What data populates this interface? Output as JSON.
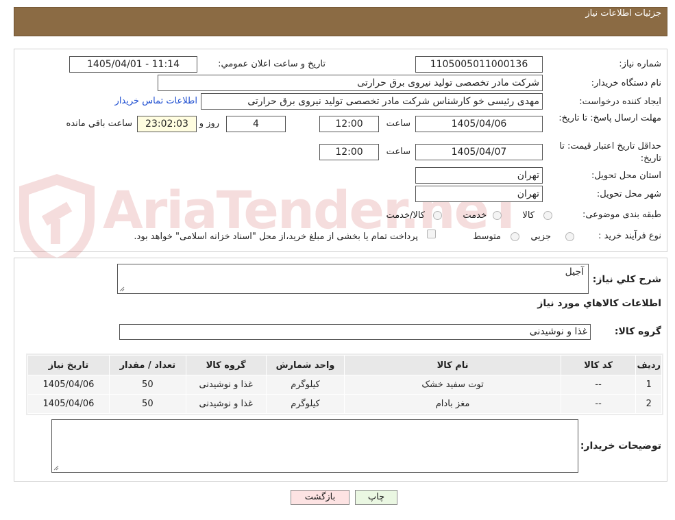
{
  "header": {
    "title": "جزئیات اطلاعات نیاز"
  },
  "form": {
    "need_number_label": "شماره نیاز:",
    "need_number": "1105005011000136",
    "announce_label": "تاریخ و ساعت اعلان عمومي:",
    "announce_value": "1405/04/01 - 11:14",
    "buyer_org_label": "نام دستگاه خريدار:",
    "buyer_org": "شرکت مادر تخصصی تولید نیروی برق حرارتی",
    "creator_label": "ايجاد کننده درخواست:",
    "creator": "مهدی رئیسی خو کارشناس شرکت مادر تخصصی تولید نیروی برق حرارتی",
    "contact_link": "اطلاعات تماس خريدار",
    "reply_deadline_label": "مهلت ارسال پاسخ: تا تاريخ:",
    "reply_date": "1405/04/06",
    "time_label": "ساعت",
    "reply_time": "12:00",
    "days_value": "4",
    "days_label": "روز و",
    "remaining_time": "23:02:03",
    "remaining_label": "ساعت باقي مانده",
    "price_validity_label": "حداقل تاريخ اعتبار قيمت: تا تاريخ:",
    "price_date": "1405/04/07",
    "price_time": "12:00",
    "province_label": "استان محل تحويل:",
    "province": "تهران",
    "city_label": "شهر محل تحويل:",
    "city": "تهران",
    "category_label": "طبقه بندی موضوعی:",
    "category_options": [
      "کالا",
      "خدمت",
      "کالا/خدمت"
    ],
    "process_label": "نوع فرآيند خريد :",
    "process_options": [
      "جزيي",
      "متوسط"
    ],
    "payment_note": "پرداخت تمام يا بخشی از مبلغ خريد،از محل \"اسناد خزانه اسلامی\" خواهد بود."
  },
  "summary": {
    "desc_label": "شرح کلي نياز:",
    "desc_value": "آجیل",
    "goods_info_title": "اطلاعات کالاهاي مورد نياز",
    "group_label": "گروه کالا:",
    "group_value": "غذا و نوشیدنی"
  },
  "table": {
    "headers": [
      "رديف",
      "کد کالا",
      "نام کالا",
      "واحد شمارش",
      "گروه کالا",
      "تعداد / مقدار",
      "تاريخ نياز"
    ],
    "rows": [
      [
        "1",
        "--",
        "توت سفید خشک",
        "کیلوگرم",
        "غذا و نوشیدنی",
        "50",
        "1405/04/06"
      ],
      [
        "2",
        "--",
        "مغز بادام",
        "کیلوگرم",
        "غذا و نوشیدنی",
        "50",
        "1405/04/06"
      ]
    ]
  },
  "buyer_notes_label": "توضيحات خريدار:",
  "buttons": {
    "print": "چاپ",
    "back": "بازگشت"
  },
  "watermark": {
    "text": "AriaTender.neT"
  },
  "colors": {
    "header": "#8b6b44",
    "back_button": "#fde3e3",
    "print_button": "#eaf7e2",
    "watermark": "#b40000"
  }
}
